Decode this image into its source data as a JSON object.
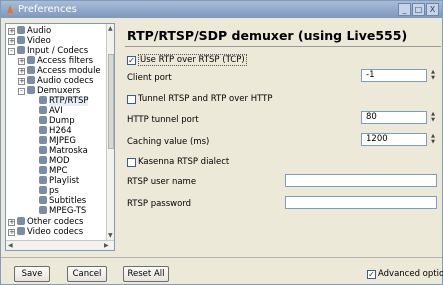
{
  "window": {
    "title": "Preferences",
    "controls": [
      "_",
      "□",
      "X"
    ]
  },
  "tree": {
    "items": [
      {
        "label": "Audio",
        "expander": "+"
      },
      {
        "label": "Video",
        "expander": "+"
      },
      {
        "label": "Input / Codecs",
        "expander": "-"
      },
      {
        "label": "Access filters",
        "expander": "+"
      },
      {
        "label": "Access module",
        "expander": "+"
      },
      {
        "label": "Audio codecs",
        "expander": "+"
      },
      {
        "label": "Demuxers",
        "expander": "-"
      },
      {
        "label": "RTP/RTSP",
        "expander": ""
      },
      {
        "label": "AVI",
        "expander": ""
      },
      {
        "label": "Dump",
        "expander": ""
      },
      {
        "label": "H264",
        "expander": ""
      },
      {
        "label": "MJPEG",
        "expander": ""
      },
      {
        "label": "Matroska",
        "expander": ""
      },
      {
        "label": "MOD",
        "expander": ""
      },
      {
        "label": "MPC",
        "expander": ""
      },
      {
        "label": "Playlist",
        "expander": ""
      },
      {
        "label": "ps",
        "expander": ""
      },
      {
        "label": "Subtitles",
        "expander": ""
      },
      {
        "label": "MPEG-TS",
        "expander": ""
      },
      {
        "label": "Other codecs",
        "expander": "+"
      },
      {
        "label": "Video codecs",
        "expander": "+"
      }
    ]
  },
  "panel": {
    "heading": "RTP/RTSP/SDP demuxer (using Live555)",
    "use_rtp_over_rtsp": {
      "label": "Use RTP over RTSP (TCP)",
      "checked": true
    },
    "client_port": {
      "label": "Client port",
      "value": "-1"
    },
    "tunnel": {
      "label": "Tunnel RTSP and RTP over HTTP",
      "checked": false
    },
    "http_tunnel_port": {
      "label": "HTTP tunnel port",
      "value": "80"
    },
    "caching": {
      "label": "Caching value (ms)",
      "value": "1200"
    },
    "kasenna": {
      "label": "Kasenna RTSP dialect",
      "checked": false
    },
    "user_name": {
      "label": "RTSP user name",
      "value": ""
    },
    "password": {
      "label": "RTSP password",
      "value": ""
    }
  },
  "buttons": {
    "save": "Save",
    "cancel": "Cancel",
    "reset": "Reset All"
  },
  "advanced": {
    "label": "Advanced options",
    "checked": true
  }
}
